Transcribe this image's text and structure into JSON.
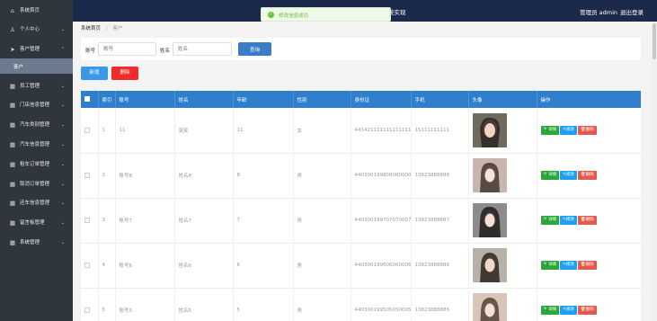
{
  "header": {
    "title_fragment": "统实现",
    "admin": "管理员 admin",
    "logout": "退出登录"
  },
  "toast": {
    "message": "修改信息成功"
  },
  "sidebar": {
    "items": [
      {
        "label": "系统首页",
        "icon": "home-icon",
        "chev": ""
      },
      {
        "label": "个人中心",
        "icon": "user-icon",
        "chev": "⌄"
      },
      {
        "label": "客户管理",
        "icon": "send-icon",
        "chev": "⌃"
      },
      {
        "label": "员工管理",
        "icon": "grid-icon",
        "chev": "⌄"
      },
      {
        "label": "门店信息管理",
        "icon": "grid-icon",
        "chev": "⌄"
      },
      {
        "label": "汽车类别管理",
        "icon": "grid-icon",
        "chev": "⌄"
      },
      {
        "label": "汽车信息管理",
        "icon": "grid-icon",
        "chev": "⌄"
      },
      {
        "label": "租车订单管理",
        "icon": "grid-icon",
        "chev": "⌄"
      },
      {
        "label": "取消订单管理",
        "icon": "grid-icon",
        "chev": "⌄"
      },
      {
        "label": "还车信息管理",
        "icon": "grid-icon",
        "chev": "⌄"
      },
      {
        "label": "留言板管理",
        "icon": "grid-icon",
        "chev": "⌄"
      },
      {
        "label": "系统管理",
        "icon": "grid-icon",
        "chev": "⌄"
      }
    ],
    "sub_item": "客户"
  },
  "breadcrumb": {
    "home": "系统首页",
    "sep": "/",
    "current": "客户"
  },
  "search": {
    "account_label": "账号",
    "account_placeholder": "账号",
    "name_label": "姓名",
    "name_placeholder": "姓名",
    "button": "查询"
  },
  "actions": {
    "add": "新增",
    "delete": "删除"
  },
  "table": {
    "headers": [
      "",
      "索引",
      "账号",
      "姓名",
      "年龄",
      "性别",
      "身份证",
      "手机",
      "头像",
      "操作"
    ],
    "rows": [
      {
        "index": "1",
        "account": "11",
        "name": "张笑",
        "age": "11",
        "gender": "女",
        "id_card": "441421111111111111",
        "phone": "15111111111"
      },
      {
        "index": "2",
        "account": "账号8",
        "name": "姓名8",
        "age": "8",
        "gender": "男",
        "id_card": "440300199808080000",
        "phone": "13823888888"
      },
      {
        "index": "3",
        "account": "账号7",
        "name": "姓名7",
        "age": "7",
        "gender": "男",
        "id_card": "440300199707070007",
        "phone": "13823888887"
      },
      {
        "index": "4",
        "account": "账号6",
        "name": "姓名6",
        "age": "6",
        "gender": "男",
        "id_card": "440300199606060006",
        "phone": "13823888886"
      },
      {
        "index": "5",
        "account": "账号5",
        "name": "姓名5",
        "age": "5",
        "gender": "男",
        "id_card": "440300199505050005",
        "phone": "13823888885"
      }
    ],
    "row_actions": {
      "detail": "详情",
      "edit": "修改",
      "delete": "删除"
    }
  },
  "colors": {
    "sidebar": "#30363d",
    "topbar": "#1b2a4a",
    "table_header": "#2f7fcc",
    "add": "#3a98e8",
    "delete": "#ef2b2b"
  }
}
